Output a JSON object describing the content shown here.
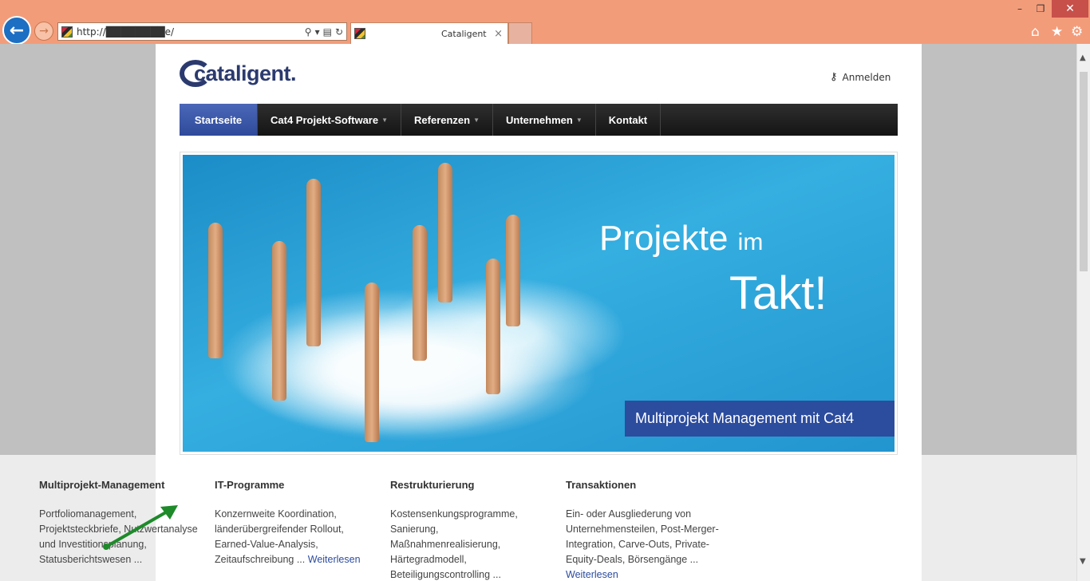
{
  "browser": {
    "url": "http://████████e/",
    "tab_title": "Cataligent",
    "tab_close": "×",
    "min": "–",
    "max": "❐",
    "close": "✕"
  },
  "site": {
    "logo": "cataligent.",
    "login_label": "Anmelden",
    "menu": [
      {
        "label": "Startseite"
      },
      {
        "label": "Cat4 Projekt-Software"
      },
      {
        "label": "Referenzen"
      },
      {
        "label": "Unternehmen"
      },
      {
        "label": "Kontakt"
      }
    ],
    "hero": {
      "line1": "Projekte",
      "line1_small": "im",
      "line2": "Takt!",
      "badge": "Multiprojekt Management mit Cat4"
    },
    "columns": [
      {
        "title": "Multiprojekt-Management",
        "text": "Portfoliomanagement, Projektsteckbriefe, Nutzwertanalyse und Investitionsplanung, Statusberichtswesen ...",
        "readmore": ""
      },
      {
        "title": "IT-Programme",
        "text": "Konzernweite Koordination, länderübergreifender Rollout, Earned-Value-Analysis, Zeitaufschreibung ...",
        "readmore": "Weiterlesen"
      },
      {
        "title": "Restrukturierung",
        "text": "Kostensenkungsprogramme, Sanierung, Maßnahmenrealisierung, Härtegradmodell, Beteiligungscontrolling ...",
        "readmore": ""
      },
      {
        "title": "Transaktionen",
        "text": "Ein- oder Ausgliederung von Unternehmensteilen, Post-Merger-Integration, Carve-Outs, Private-Equity-Deals, Börsengänge ...",
        "readmore": "Weiterlesen"
      }
    ]
  },
  "colors": {
    "accent": "#2c4c9e",
    "chrome": "#f39c7a",
    "annotation_arrow": "#1e8a2a"
  },
  "icons": [
    "back-arrow-icon",
    "forward-arrow-icon",
    "search-icon",
    "refresh-icon",
    "home-icon",
    "star-icon",
    "gear-icon",
    "key-icon"
  ]
}
